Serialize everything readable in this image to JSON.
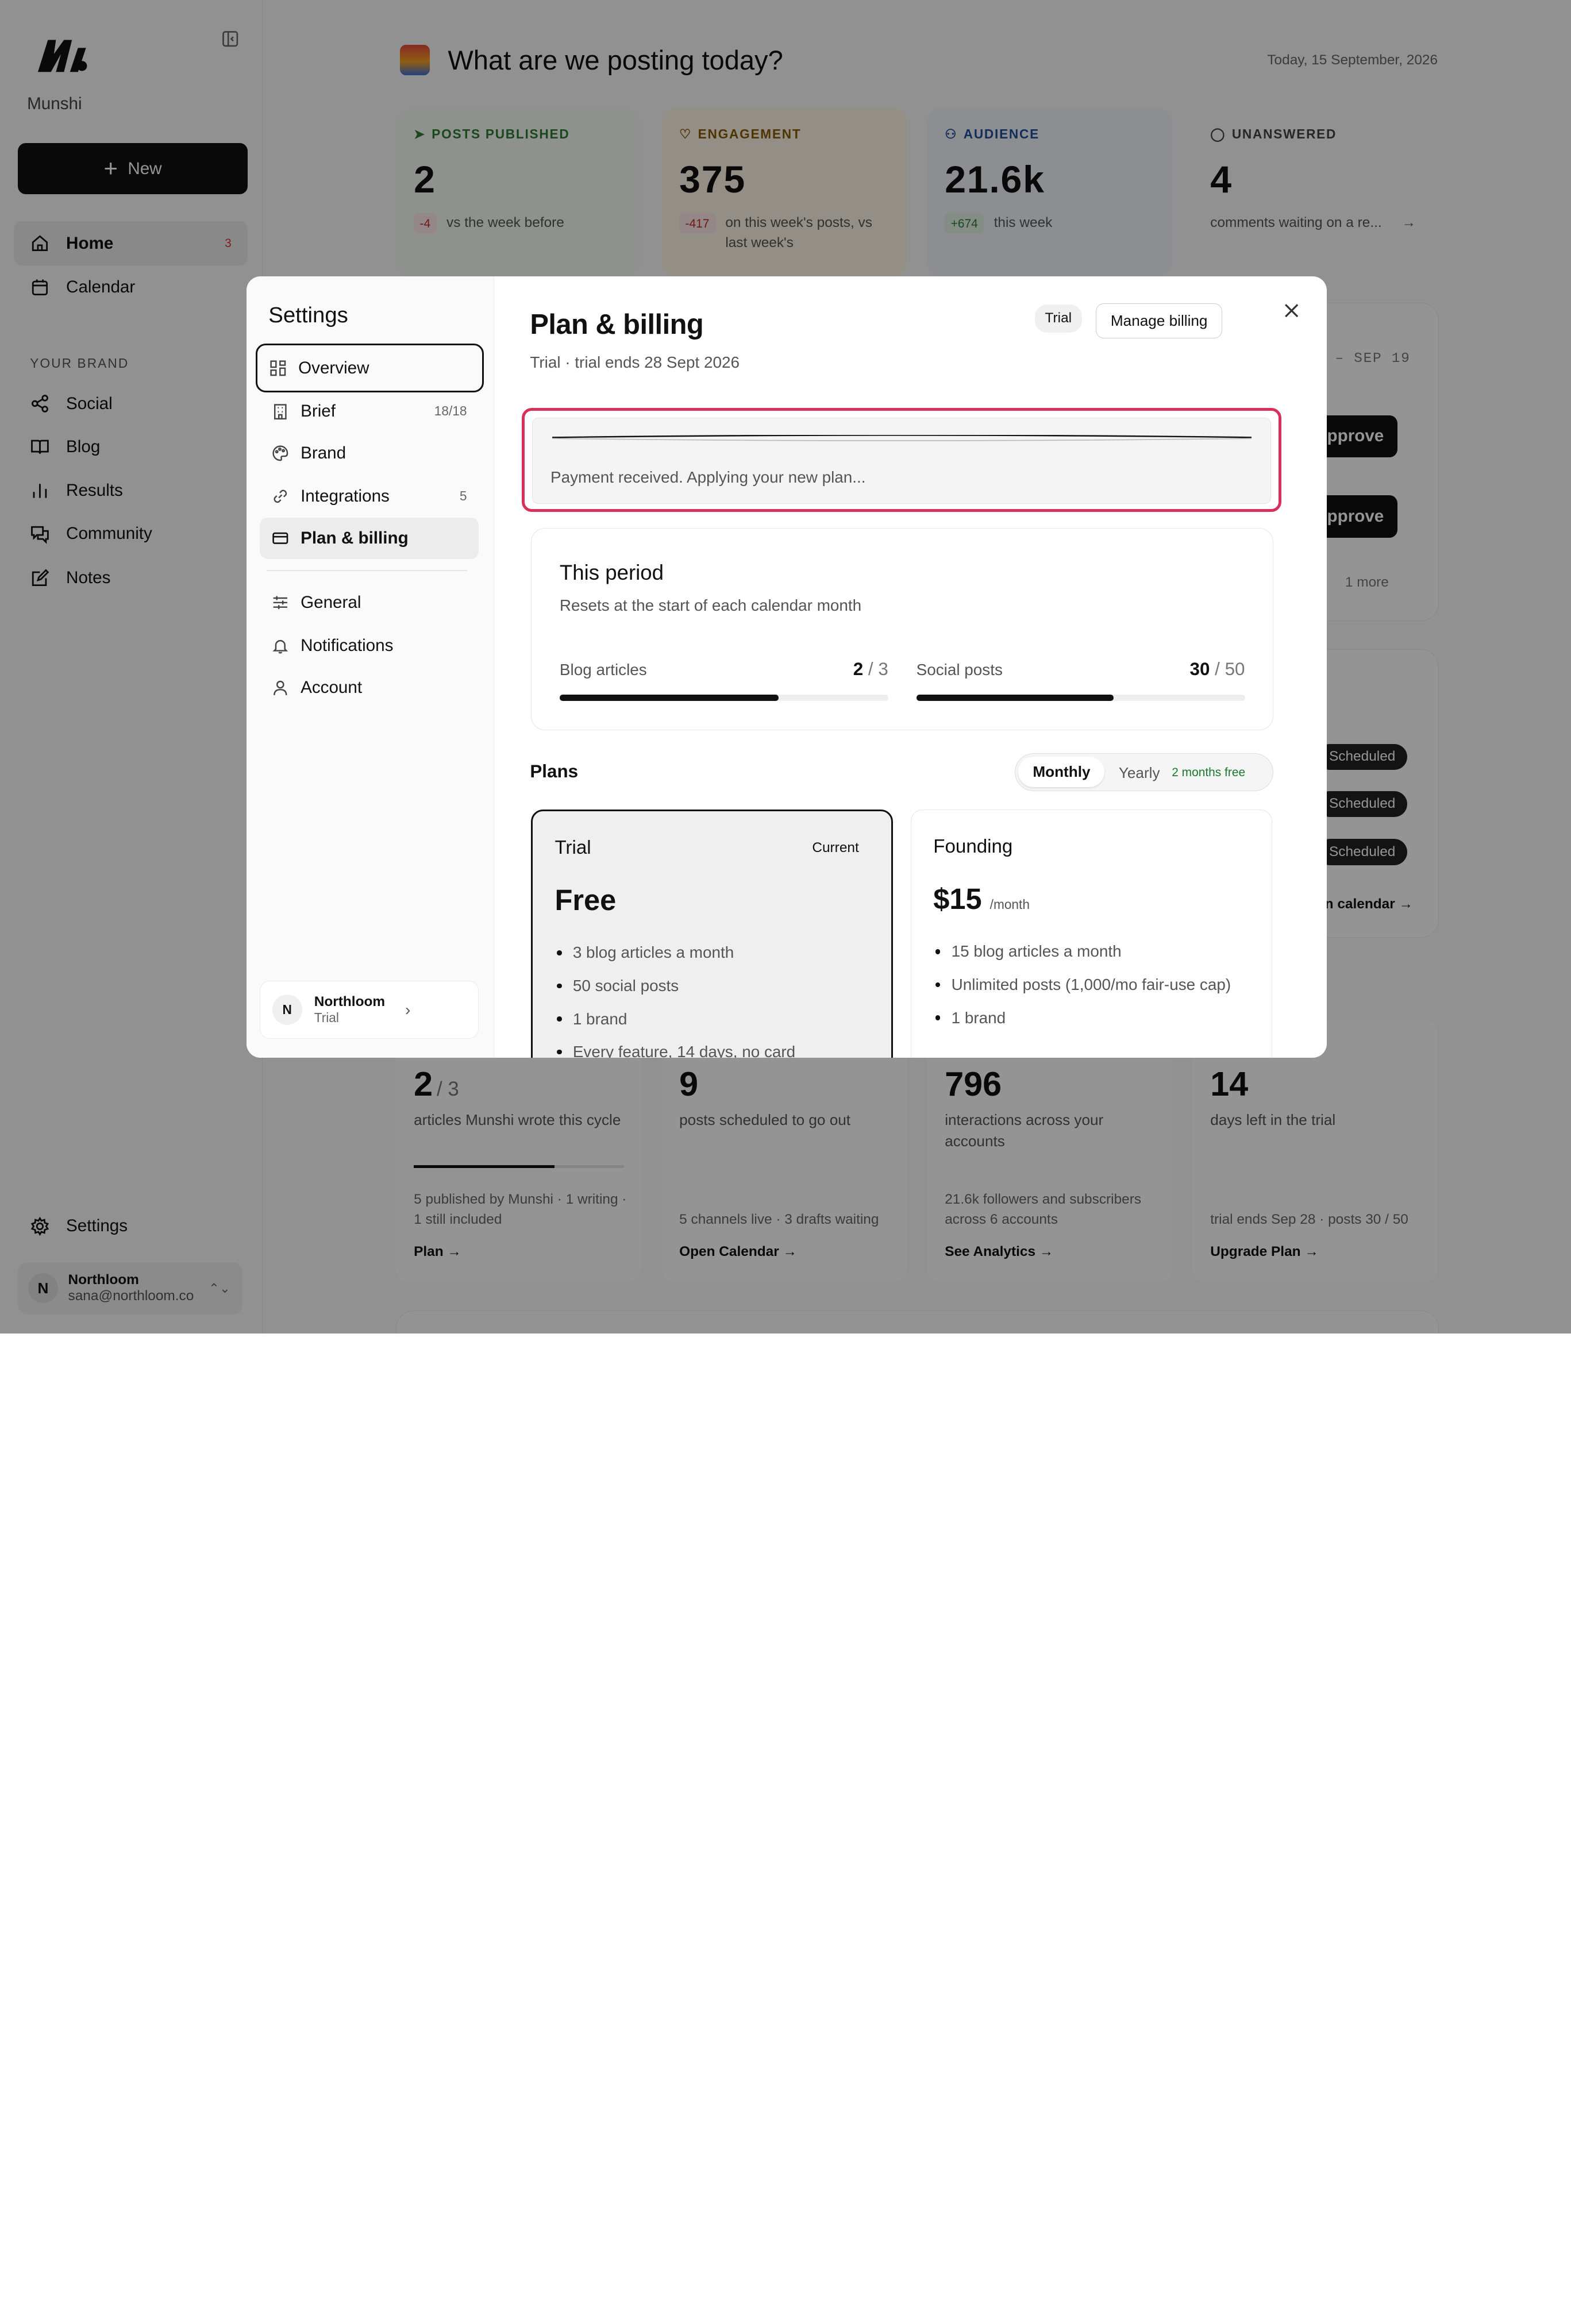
{
  "sidebar": {
    "brand_name": "Munshi",
    "new_label": "New",
    "nav": [
      {
        "label": "Home",
        "badge": "3"
      },
      {
        "label": "Calendar"
      }
    ],
    "section_label": "YOUR BRAND",
    "brand_nav": [
      {
        "label": "Social"
      },
      {
        "label": "Blog"
      },
      {
        "label": "Results"
      },
      {
        "label": "Community"
      },
      {
        "label": "Notes"
      }
    ],
    "settings_label": "Settings",
    "user": {
      "initial": "N",
      "name": "Northloom",
      "email": "sana@northloom.co"
    }
  },
  "header": {
    "title": "What are we posting today?",
    "date": "Today, 15 September, 2026"
  },
  "stats": [
    {
      "label": "POSTS PUBLISHED",
      "value": "2",
      "chip": "-4",
      "text": "vs the week before",
      "color": "#2e7d32"
    },
    {
      "label": "ENGAGEMENT",
      "value": "375",
      "chip": "-417",
      "text": "on this week's posts, vs last week's",
      "color": "#8a5a00"
    },
    {
      "label": "AUDIENCE",
      "value": "21.6k",
      "chip": "+674",
      "text": "this week",
      "color": "#1f4e99"
    },
    {
      "label": "UNANSWERED",
      "value": "4",
      "text": "comments waiting on a re...",
      "color": "#444"
    }
  ],
  "background": {
    "range_label": "– SEP 19",
    "approve_label": "pprove",
    "more_label": "1 more",
    "scheduled_label": "Scheduled",
    "calendar_link": "en calendar →"
  },
  "bottom_cards": [
    {
      "value": "2",
      "value_suffix": "/ 3",
      "desc": "articles Munshi wrote this cycle",
      "progress": 0.67,
      "foot": "5 published by Munshi · 1 writing · 1 still included",
      "link": "Plan →"
    },
    {
      "value": "9",
      "desc": "posts scheduled to go out",
      "foot": "5 channels live · 3 drafts waiting",
      "link": "Open Calendar →"
    },
    {
      "value": "796",
      "desc": "interactions across your accounts",
      "foot": "21.6k followers and subscribers across 6 accounts",
      "link": "See Analytics →"
    },
    {
      "value": "14",
      "desc": "days left in the trial",
      "foot": "trial ends Sep 28 · posts 30 / 50",
      "link": "Upgrade Plan →"
    }
  ],
  "modal": {
    "settings_title": "Settings",
    "menu": [
      {
        "label": "Overview",
        "icon": "grid-icon"
      },
      {
        "label": "Brief",
        "count": "18/18",
        "icon": "building-icon"
      },
      {
        "label": "Brand",
        "icon": "palette-icon"
      },
      {
        "label": "Integrations",
        "count": "5",
        "icon": "link-icon"
      },
      {
        "label": "Plan & billing",
        "icon": "card-icon"
      }
    ],
    "menu2": [
      {
        "label": "General",
        "icon": "sliders-icon"
      },
      {
        "label": "Notifications",
        "icon": "bell-icon"
      },
      {
        "label": "Account",
        "icon": "user-icon"
      }
    ],
    "workspace": {
      "initial": "N",
      "name": "Northloom",
      "plan": "Trial"
    },
    "title": "Plan & billing",
    "subtitle": "Trial · trial ends 28 Sept 2026",
    "trial_chip": "Trial",
    "manage_billing": "Manage billing",
    "alert_text": "Payment received. Applying your new plan...",
    "period": {
      "title": "This period",
      "subtitle": "Resets at the start of each calendar month",
      "meters": [
        {
          "label": "Blog articles",
          "used": "2",
          "total": "3",
          "fraction": 0.667
        },
        {
          "label": "Social posts",
          "used": "30",
          "total": "50",
          "fraction": 0.6
        }
      ]
    },
    "plans_title": "Plans",
    "billing_toggle": {
      "monthly": "Monthly",
      "yearly": "Yearly",
      "yearly_badge": "2 months free",
      "selected": "Monthly"
    },
    "plans": [
      {
        "name": "Trial",
        "tag": "Current",
        "price": "Free",
        "per": "",
        "features": [
          "3 blog articles a month",
          "50 social posts",
          "1 brand",
          "Every feature, 14 days, no card"
        ]
      },
      {
        "name": "Founding",
        "tag": "",
        "price": "$15",
        "per": "/month",
        "features": [
          "15 blog articles a month",
          "Unlimited posts (1,000/mo fair-use cap)",
          "1 brand"
        ]
      }
    ]
  }
}
